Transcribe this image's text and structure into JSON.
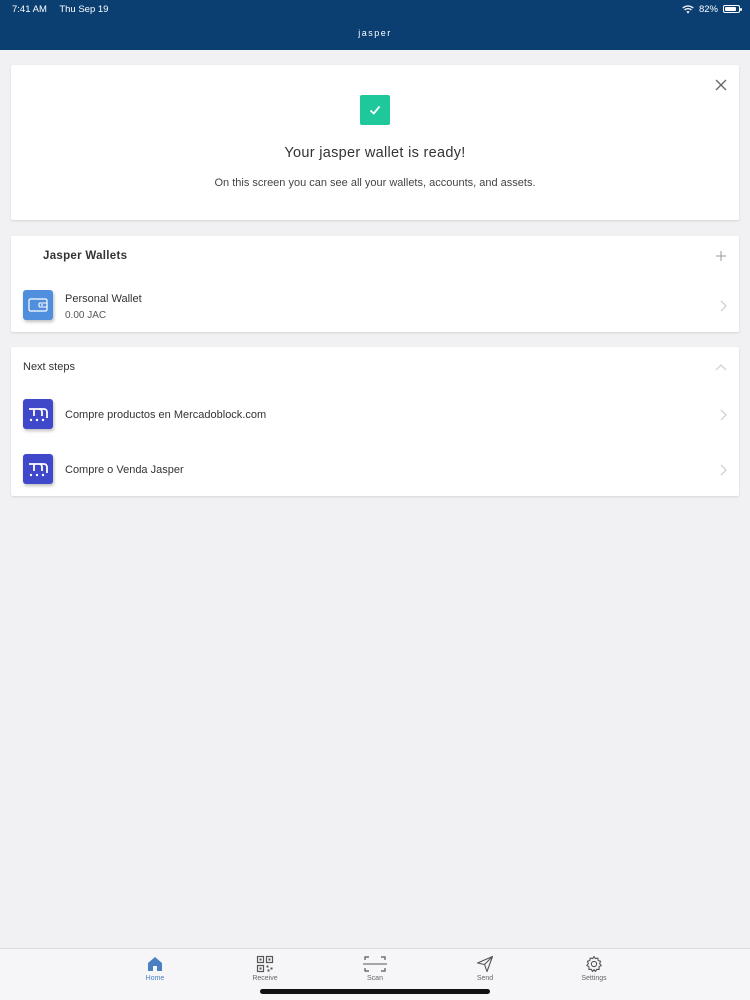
{
  "status_bar": {
    "time": "7:41 AM",
    "date": "Thu Sep 19",
    "battery": "82%",
    "battery_level": 0.82
  },
  "header": {
    "title": "jasper",
    "background_color": "#0b3f72"
  },
  "ready_card": {
    "title": "Your jasper wallet is ready!",
    "description": "On this screen you can see all your wallets, accounts, and assets.",
    "check_color": "#1fc89a"
  },
  "wallets": {
    "title": "Jasper Wallets",
    "items": [
      {
        "name": "Personal Wallet",
        "balance": "0.00 JAC",
        "icon": "wallet-icon"
      }
    ]
  },
  "next_steps": {
    "title": "Next steps",
    "items": [
      {
        "label": "Compre productos en Mercadoblock.com",
        "icon": "mercadoblock-icon"
      },
      {
        "label": "Compre o Venda Jasper",
        "icon": "mercadoblock-icon"
      }
    ]
  },
  "tabbar": {
    "active_color": "#4a7fc1",
    "tabs": [
      {
        "label": "Home",
        "icon": "home-icon",
        "active": true
      },
      {
        "label": "Receive",
        "icon": "qr-icon",
        "active": false
      },
      {
        "label": "Scan",
        "icon": "scan-icon",
        "active": false
      },
      {
        "label": "Send",
        "icon": "send-icon",
        "active": false
      },
      {
        "label": "Settings",
        "icon": "gear-icon",
        "active": false
      }
    ]
  }
}
